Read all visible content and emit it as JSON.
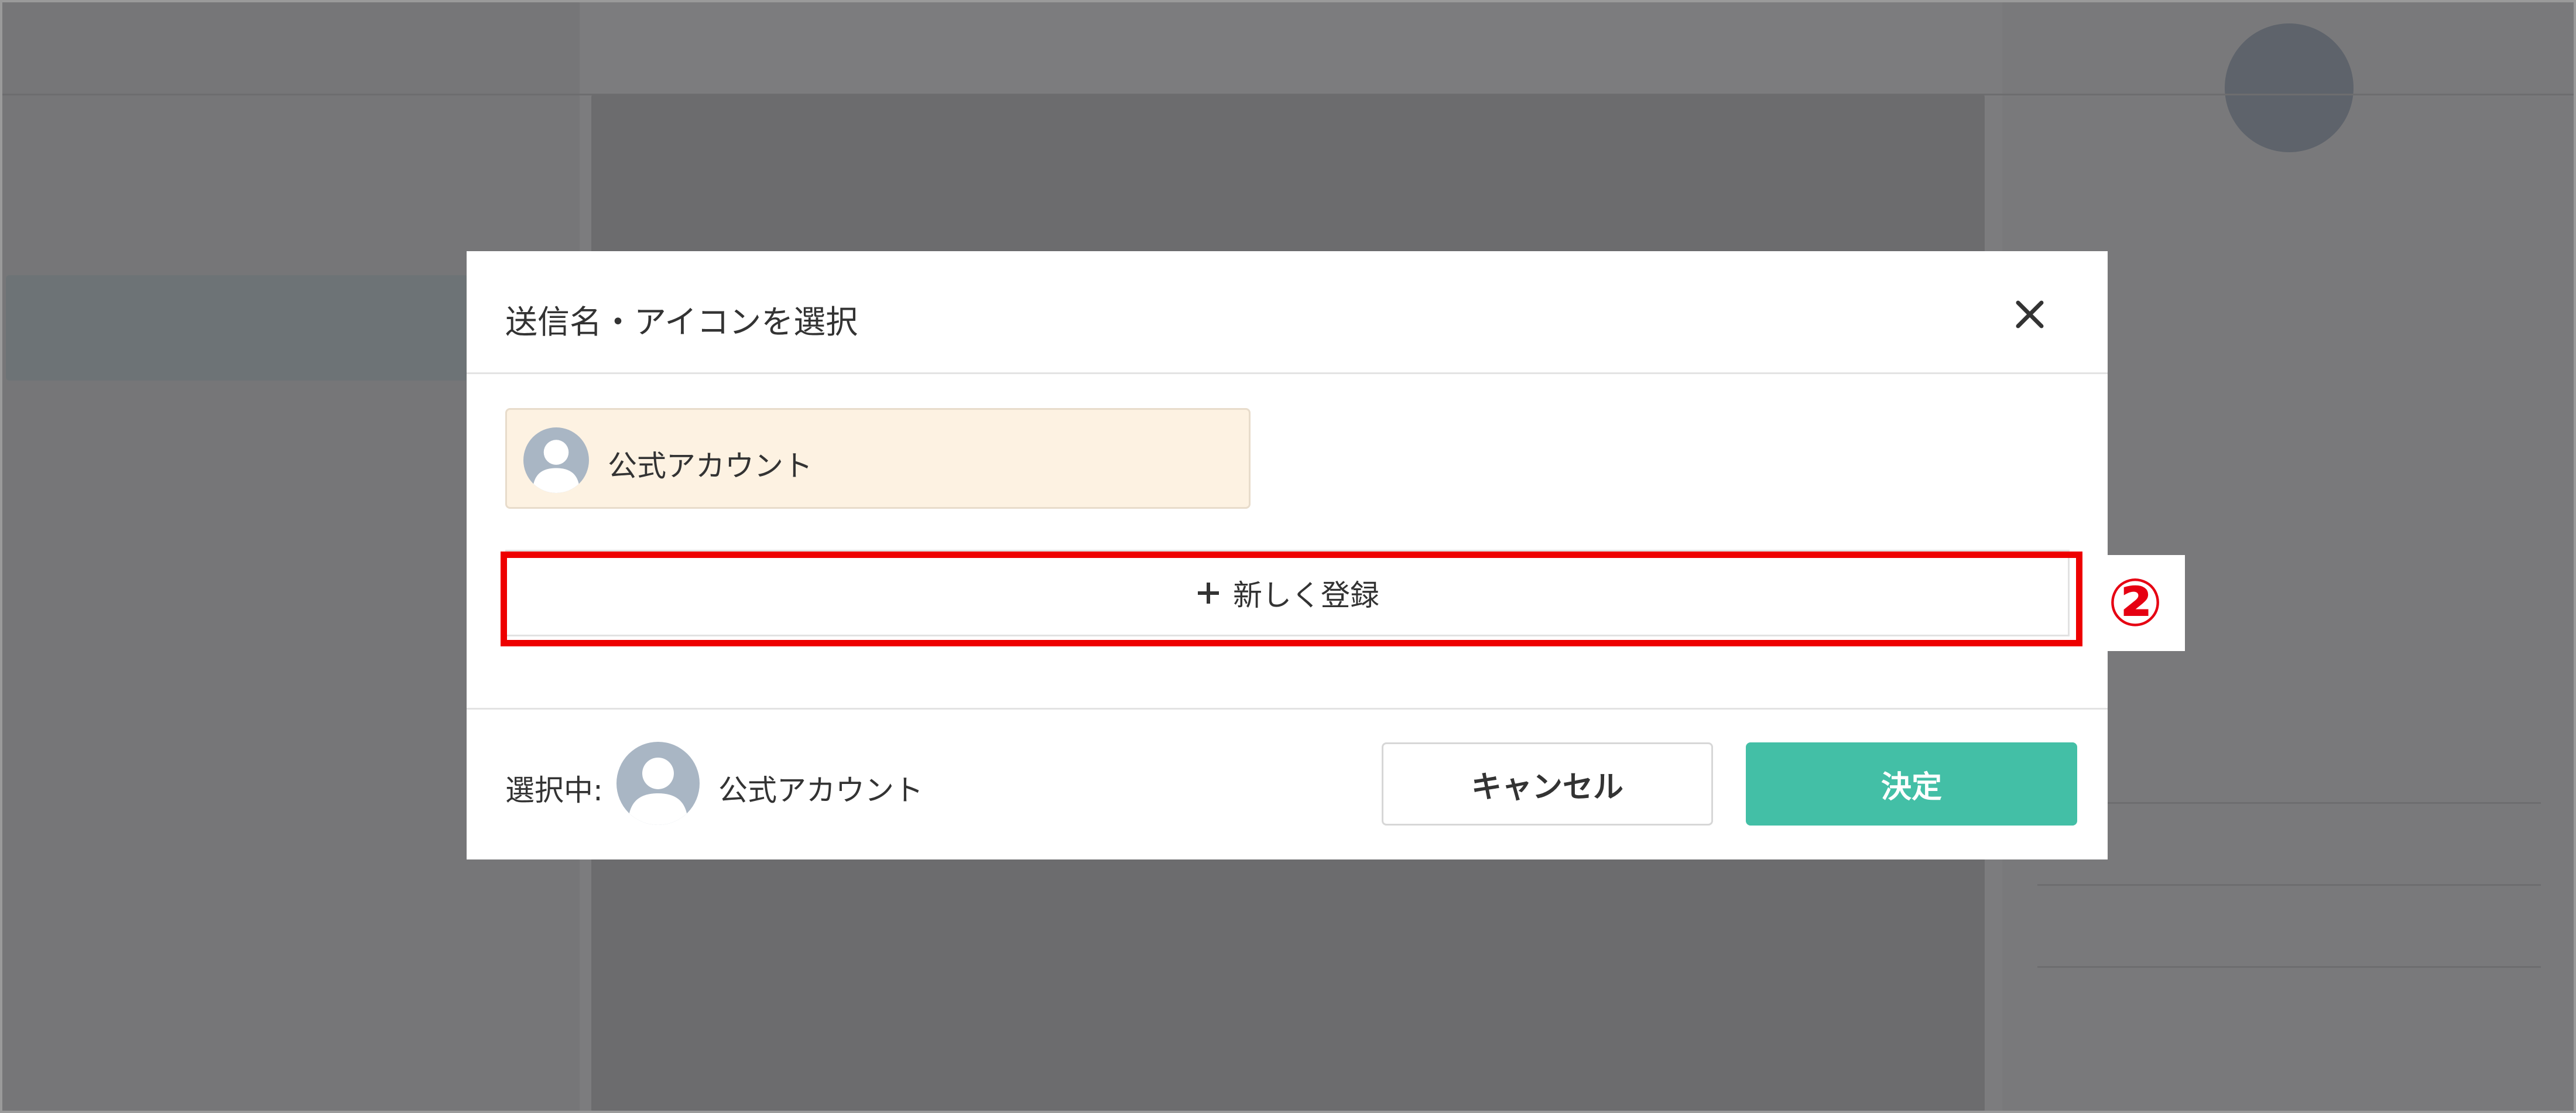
{
  "modal": {
    "title": "送信名・アイコンを選択",
    "close_icon": "close-icon",
    "accounts": [
      {
        "name": "公式アカウント",
        "icon": "default-person-avatar",
        "selected": true
      }
    ],
    "new_register_label": "新しく登録",
    "new_register_icon": "plus-icon",
    "footer": {
      "selected_label": "選択中:",
      "selected_name": "公式アカウント",
      "cancel_label": "キャンセル",
      "confirm_label": "決定"
    }
  },
  "annotation": {
    "marker": "②",
    "color": "#ee0000"
  },
  "colors": {
    "accent": "#43bfa6",
    "selected_card_bg": "#fdf2e2",
    "avatar_bg": "#a9b6c4"
  }
}
